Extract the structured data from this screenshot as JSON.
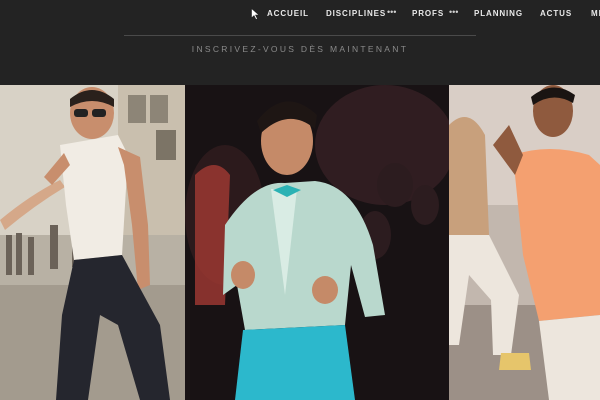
{
  "nav": {
    "items": [
      {
        "label": "ACCUEIL"
      },
      {
        "label": "DISCIPLINES"
      },
      {
        "label": "PROFS"
      },
      {
        "label": "PLANNING"
      },
      {
        "label": "ACTUS"
      },
      {
        "label": "ME"
      }
    ],
    "more_glyph": "•••"
  },
  "cta": {
    "label": "INSCRIVEZ-VOUS DÈS MAINTENANT"
  },
  "colors": {
    "header_bg": "#232323",
    "nav_text": "#e9e9e9",
    "cta_text": "#8a8a8a"
  }
}
